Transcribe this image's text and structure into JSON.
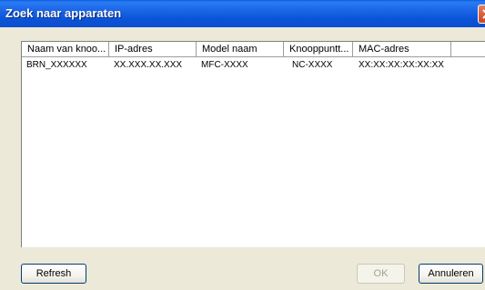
{
  "window": {
    "title": "Zoek naar apparaten"
  },
  "list": {
    "columns": [
      "Naam van knoo...",
      "IP-adres",
      "Model naam",
      "Knooppuntt...",
      "MAC-adres"
    ],
    "rows": [
      [
        "BRN_XXXXXX",
        "XX.XXX.XX.XXX",
        "MFC-XXXX",
        "NC-XXXX",
        "XX:XX:XX:XX:XX:XX"
      ]
    ]
  },
  "buttons": {
    "refresh": "Refresh",
    "ok": "OK",
    "cancel": "Annuleren"
  },
  "icons": {
    "close": "close-icon"
  },
  "colors": {
    "titlebar": "#0b53d8",
    "close_button": "#c9451f",
    "dialog_background": "#ece9d8"
  }
}
